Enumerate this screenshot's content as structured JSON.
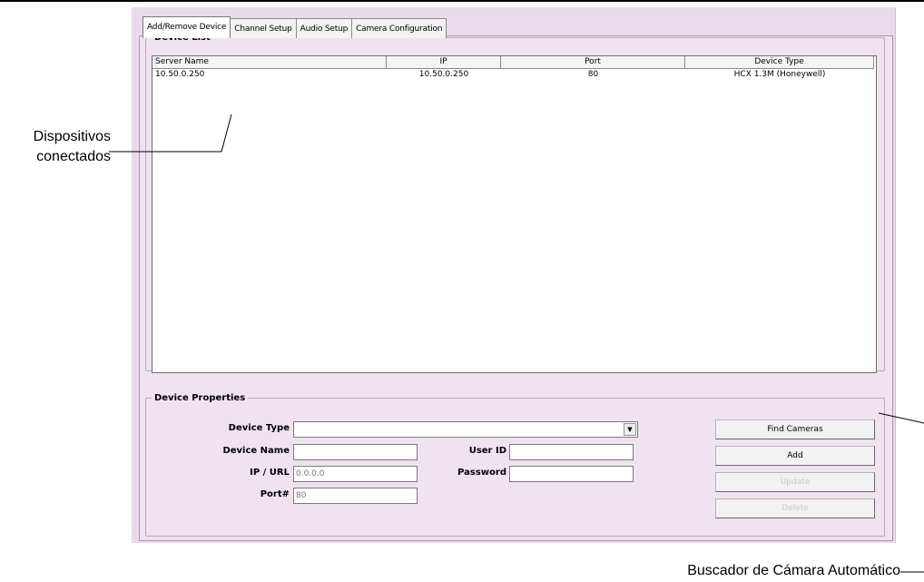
{
  "tabs": [
    "Add/Remove Device",
    "Channel Setup",
    "Audio Setup",
    "Camera Configuration"
  ],
  "device_list": {
    "legend": "Device List",
    "columns": [
      "Server Name",
      "IP",
      "Port",
      "Device Type"
    ],
    "rows": [
      {
        "server": "10.50.0.250",
        "ip": "10.50.0.250",
        "port": "80",
        "type": "HCX 1.3M (Honeywell)"
      }
    ]
  },
  "device_properties": {
    "legend": "Device Properties",
    "device_type_label": "Device Type",
    "device_type_value": "",
    "device_name_label": "Device Name",
    "device_name_value": "",
    "ip_label": "IP / URL",
    "ip_value": "0.0.0.0",
    "port_label": "Port#",
    "port_value": "80",
    "user_id_label": "User ID",
    "user_id_value": "",
    "password_label": "Password",
    "password_value": ""
  },
  "buttons": {
    "find_cameras": "Find Cameras",
    "add": "Add",
    "update": "Update",
    "delete": "Delete"
  },
  "annotations": {
    "connected_line1": "Dispositivos",
    "connected_line2": "conectados",
    "auto_finder": "Buscador de Cámara Automático"
  }
}
